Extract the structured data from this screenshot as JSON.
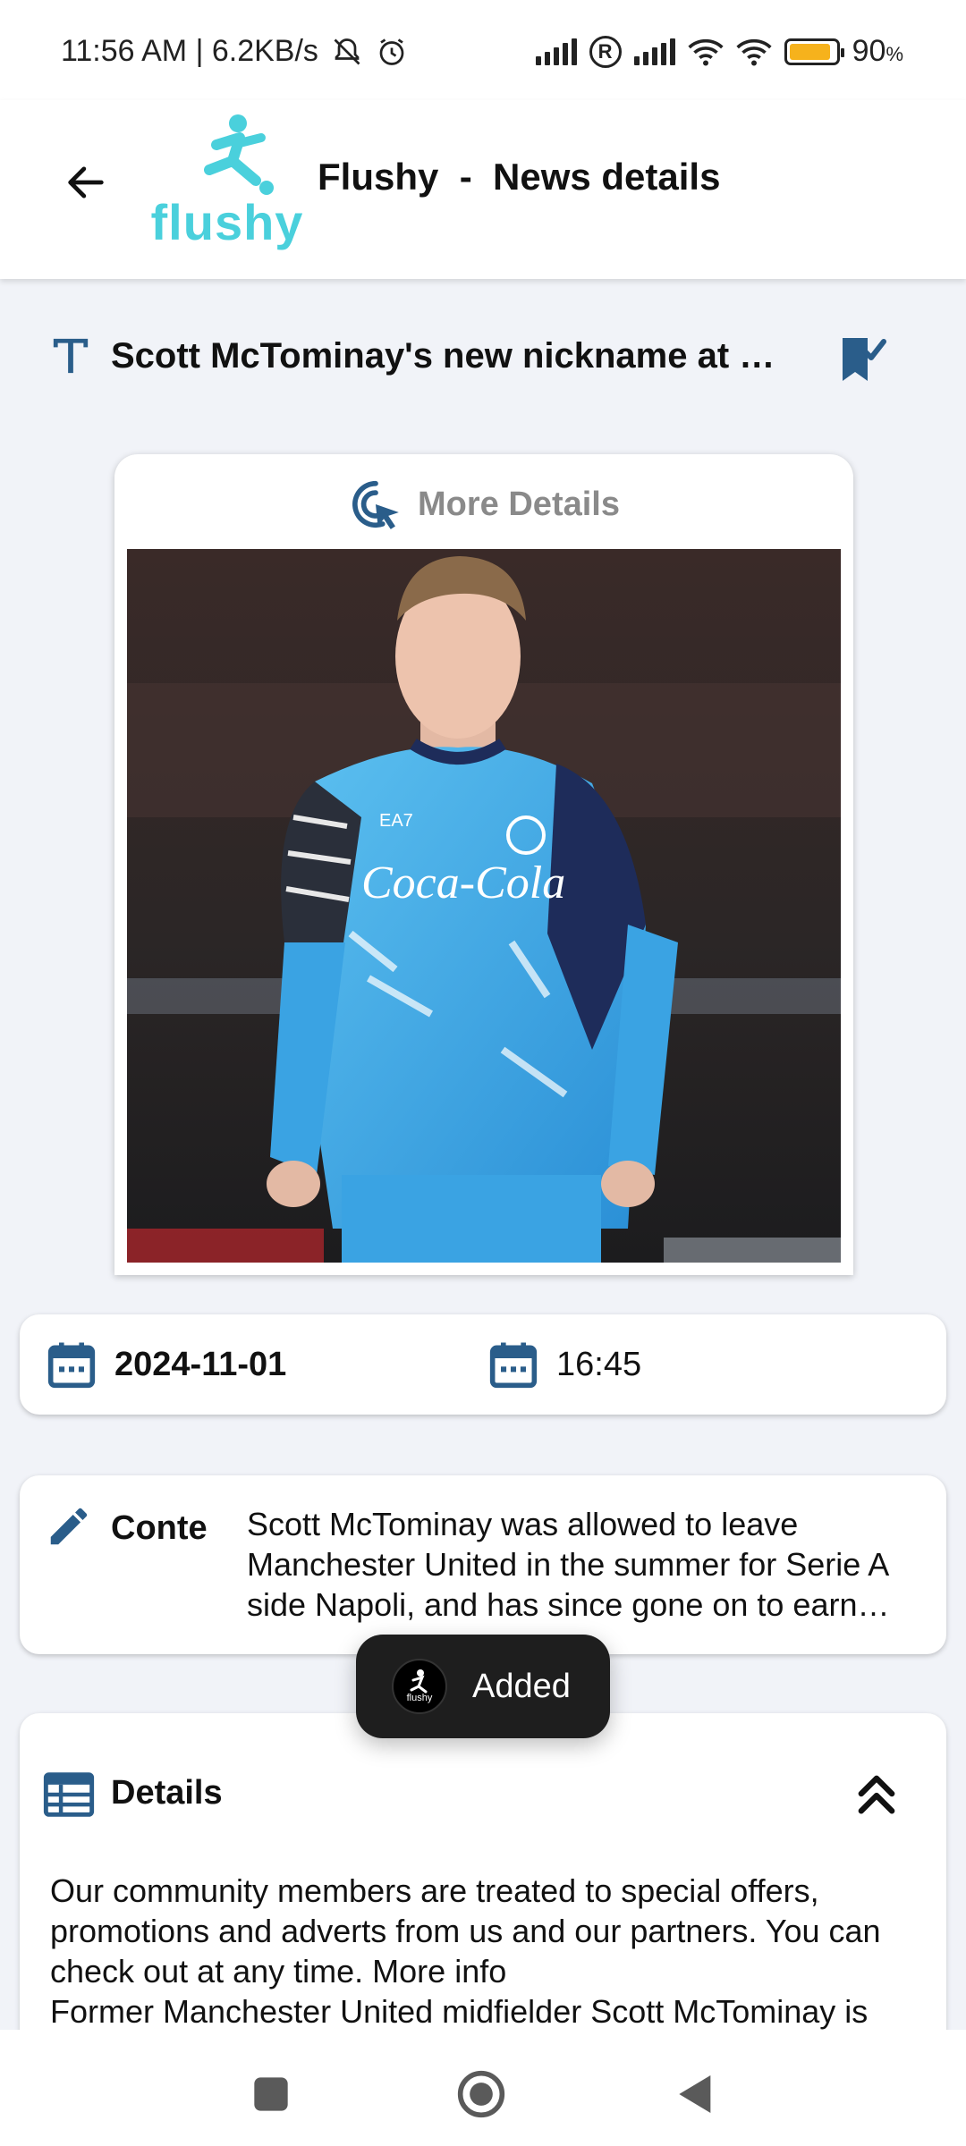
{
  "status": {
    "time_speed": "11:56 AM | 6.2KB/s",
    "battery": "90"
  },
  "app_bar": {
    "logo_text": "flushy",
    "title": "Flushy  -  News details"
  },
  "article": {
    "title": "Scott McTominay's new nickname at Napoli revealed",
    "more_details_label": "More Details",
    "date": "2024-11-01",
    "time": "16:45",
    "content_label": "Conte",
    "content_text": "Scott McTominay was allowed to leave Manchester United in the summer for Serie A side Napoli, and has since gone on to earn plenty of praise.",
    "details_label": "Details",
    "details_text": "Our community members are treated to special offers, promotions and adverts from us and our partners. You can check out at any time. More info",
    "details_text_2": "Former Manchester United midfielder Scott McTominay is"
  },
  "toast": {
    "logo_text": "flushy",
    "message": "Added"
  },
  "colors": {
    "accent": "#2a5d8a",
    "logo": "#4ad0dc",
    "jersey": "#3aa3e3"
  }
}
